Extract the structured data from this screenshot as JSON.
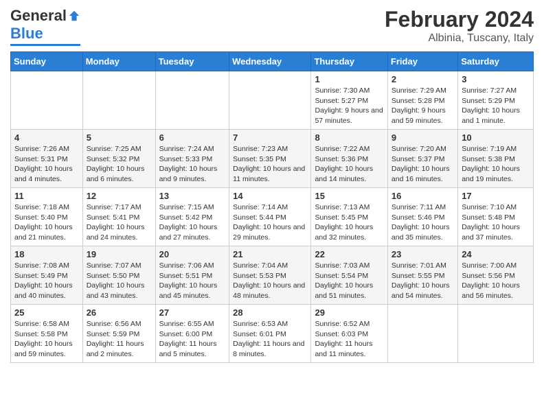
{
  "header": {
    "logo_general": "General",
    "logo_blue": "Blue",
    "main_title": "February 2024",
    "subtitle": "Albinia, Tuscany, Italy"
  },
  "calendar": {
    "days_of_week": [
      "Sunday",
      "Monday",
      "Tuesday",
      "Wednesday",
      "Thursday",
      "Friday",
      "Saturday"
    ],
    "weeks": [
      [
        {
          "day": "",
          "detail": ""
        },
        {
          "day": "",
          "detail": ""
        },
        {
          "day": "",
          "detail": ""
        },
        {
          "day": "",
          "detail": ""
        },
        {
          "day": "1",
          "detail": "Sunrise: 7:30 AM\nSunset: 5:27 PM\nDaylight: 9 hours and 57 minutes."
        },
        {
          "day": "2",
          "detail": "Sunrise: 7:29 AM\nSunset: 5:28 PM\nDaylight: 9 hours and 59 minutes."
        },
        {
          "day": "3",
          "detail": "Sunrise: 7:27 AM\nSunset: 5:29 PM\nDaylight: 10 hours and 1 minute."
        }
      ],
      [
        {
          "day": "4",
          "detail": "Sunrise: 7:26 AM\nSunset: 5:31 PM\nDaylight: 10 hours and 4 minutes."
        },
        {
          "day": "5",
          "detail": "Sunrise: 7:25 AM\nSunset: 5:32 PM\nDaylight: 10 hours and 6 minutes."
        },
        {
          "day": "6",
          "detail": "Sunrise: 7:24 AM\nSunset: 5:33 PM\nDaylight: 10 hours and 9 minutes."
        },
        {
          "day": "7",
          "detail": "Sunrise: 7:23 AM\nSunset: 5:35 PM\nDaylight: 10 hours and 11 minutes."
        },
        {
          "day": "8",
          "detail": "Sunrise: 7:22 AM\nSunset: 5:36 PM\nDaylight: 10 hours and 14 minutes."
        },
        {
          "day": "9",
          "detail": "Sunrise: 7:20 AM\nSunset: 5:37 PM\nDaylight: 10 hours and 16 minutes."
        },
        {
          "day": "10",
          "detail": "Sunrise: 7:19 AM\nSunset: 5:38 PM\nDaylight: 10 hours and 19 minutes."
        }
      ],
      [
        {
          "day": "11",
          "detail": "Sunrise: 7:18 AM\nSunset: 5:40 PM\nDaylight: 10 hours and 21 minutes."
        },
        {
          "day": "12",
          "detail": "Sunrise: 7:17 AM\nSunset: 5:41 PM\nDaylight: 10 hours and 24 minutes."
        },
        {
          "day": "13",
          "detail": "Sunrise: 7:15 AM\nSunset: 5:42 PM\nDaylight: 10 hours and 27 minutes."
        },
        {
          "day": "14",
          "detail": "Sunrise: 7:14 AM\nSunset: 5:44 PM\nDaylight: 10 hours and 29 minutes."
        },
        {
          "day": "15",
          "detail": "Sunrise: 7:13 AM\nSunset: 5:45 PM\nDaylight: 10 hours and 32 minutes."
        },
        {
          "day": "16",
          "detail": "Sunrise: 7:11 AM\nSunset: 5:46 PM\nDaylight: 10 hours and 35 minutes."
        },
        {
          "day": "17",
          "detail": "Sunrise: 7:10 AM\nSunset: 5:48 PM\nDaylight: 10 hours and 37 minutes."
        }
      ],
      [
        {
          "day": "18",
          "detail": "Sunrise: 7:08 AM\nSunset: 5:49 PM\nDaylight: 10 hours and 40 minutes."
        },
        {
          "day": "19",
          "detail": "Sunrise: 7:07 AM\nSunset: 5:50 PM\nDaylight: 10 hours and 43 minutes."
        },
        {
          "day": "20",
          "detail": "Sunrise: 7:06 AM\nSunset: 5:51 PM\nDaylight: 10 hours and 45 minutes."
        },
        {
          "day": "21",
          "detail": "Sunrise: 7:04 AM\nSunset: 5:53 PM\nDaylight: 10 hours and 48 minutes."
        },
        {
          "day": "22",
          "detail": "Sunrise: 7:03 AM\nSunset: 5:54 PM\nDaylight: 10 hours and 51 minutes."
        },
        {
          "day": "23",
          "detail": "Sunrise: 7:01 AM\nSunset: 5:55 PM\nDaylight: 10 hours and 54 minutes."
        },
        {
          "day": "24",
          "detail": "Sunrise: 7:00 AM\nSunset: 5:56 PM\nDaylight: 10 hours and 56 minutes."
        }
      ],
      [
        {
          "day": "25",
          "detail": "Sunrise: 6:58 AM\nSunset: 5:58 PM\nDaylight: 10 hours and 59 minutes."
        },
        {
          "day": "26",
          "detail": "Sunrise: 6:56 AM\nSunset: 5:59 PM\nDaylight: 11 hours and 2 minutes."
        },
        {
          "day": "27",
          "detail": "Sunrise: 6:55 AM\nSunset: 6:00 PM\nDaylight: 11 hours and 5 minutes."
        },
        {
          "day": "28",
          "detail": "Sunrise: 6:53 AM\nSunset: 6:01 PM\nDaylight: 11 hours and 8 minutes."
        },
        {
          "day": "29",
          "detail": "Sunrise: 6:52 AM\nSunset: 6:03 PM\nDaylight: 11 hours and 11 minutes."
        },
        {
          "day": "",
          "detail": ""
        },
        {
          "day": "",
          "detail": ""
        }
      ]
    ]
  }
}
